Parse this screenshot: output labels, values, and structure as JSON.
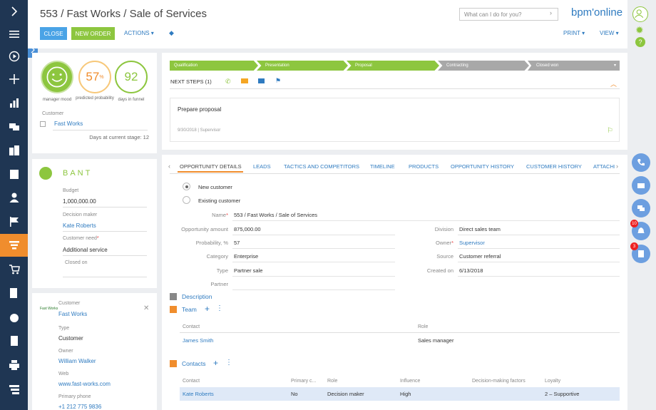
{
  "header": {
    "title": "553 / Fast Works / Sale of Services",
    "search_placeholder": "What can I do for you?",
    "logo": "bpm'online",
    "close_label": "CLOSE",
    "new_order_label": "NEW ORDER",
    "actions_label": "ACTIONS",
    "print_label": "PRINT",
    "view_label": "VIEW"
  },
  "colors": {
    "nav_bg": "#1f3653",
    "accent": "#f08d2d",
    "green": "#8dc63f",
    "blue": "#2f7bc0",
    "close_btn": "#4aa3e6",
    "stage_gray": "#a8a8a8"
  },
  "nav": {
    "icons": [
      "expand-icon",
      "menu-icon",
      "play-icon",
      "plus-icon",
      "chart-icon",
      "chat-icon",
      "accounts-icon",
      "building-icon",
      "contact-icon",
      "flag-icon",
      "funnel-icon",
      "cart-icon",
      "document-edit-icon",
      "money-icon",
      "document-icon",
      "printer-icon",
      "stack-icon"
    ]
  },
  "metrics": {
    "mood_label": "manager mood",
    "probability": "57",
    "probability_unit": "%",
    "probability_label": "predicted probability",
    "days": "92",
    "days_label": "days in funnel",
    "customer_label": "Customer",
    "customer_value": "Fast Works",
    "days_stage": "Days at current stage: 12"
  },
  "bant": {
    "title": "BANT",
    "budget_label": "Budget",
    "budget_value": "1,000,000.00",
    "decision_maker_label": "Decision maker",
    "decision_maker_value": "Kate Roberts",
    "need_label": "Customer need",
    "need_value": "Additional service",
    "closed_on_label": "Closed on"
  },
  "customer_card": {
    "customer_label": "Customer",
    "customer_value": "Fast Works",
    "type_label": "Type",
    "type_value": "Customer",
    "owner_label": "Owner",
    "owner_value": "William Walker",
    "web_label": "Web",
    "web_value": "www.fast-works.com",
    "phone_label": "Primary phone",
    "phone_value": "+1 212 775 9836",
    "logo_text": "Fast Works"
  },
  "stages": [
    "Qualification",
    "Presentation",
    "Proposal",
    "Contracting",
    "Closed won"
  ],
  "next_steps": {
    "label": "NEXT STEPS (1)",
    "task": "Prepare proposal",
    "date": "9/30/2018",
    "owner": "Supervisor"
  },
  "tabs": [
    "OPPORTUNITY DETAILS",
    "LEADS",
    "TACTICS AND COMPETITORS",
    "TIMELINE",
    "PRODUCTS",
    "OPPORTUNITY HISTORY",
    "CUSTOMER HISTORY",
    "ATTACHI"
  ],
  "details": {
    "new_customer": "New customer",
    "existing_customer": "Existing customer",
    "name_label": "Name",
    "name_value": "553 / Fast Works / Sale of Services",
    "amount_label": "Opportunity amount",
    "amount_value": "875,000.00",
    "probability_label": "Probability, %",
    "probability_value": "57",
    "category_label": "Category",
    "category_value": "Enterprise",
    "type_label": "Type",
    "type_value": "Partner sale",
    "partner_label": "Partner",
    "division_label": "Division",
    "division_value": "Direct sales team",
    "owner_label": "Owner",
    "owner_value": "Supervisor",
    "source_label": "Source",
    "source_value": "Customer referral",
    "created_label": "Created on",
    "created_value": "6/13/2018"
  },
  "sections": {
    "description": "Description",
    "team": "Team",
    "contacts": "Contacts"
  },
  "team_table": {
    "headers": [
      "Contact",
      "Role"
    ],
    "rows": [
      [
        "James Smith",
        "Sales manager"
      ]
    ]
  },
  "contacts_table": {
    "headers": [
      "Contact",
      "Primary c...",
      "Role",
      "Influence",
      "Decision-making factors",
      "Loyalty"
    ],
    "rows": [
      [
        "Kate Roberts",
        "No",
        "Decision maker",
        "High",
        "",
        "2 – Supportive"
      ]
    ]
  },
  "right_bar": {
    "badge_notifications": "10",
    "badge_tasks": "3"
  }
}
